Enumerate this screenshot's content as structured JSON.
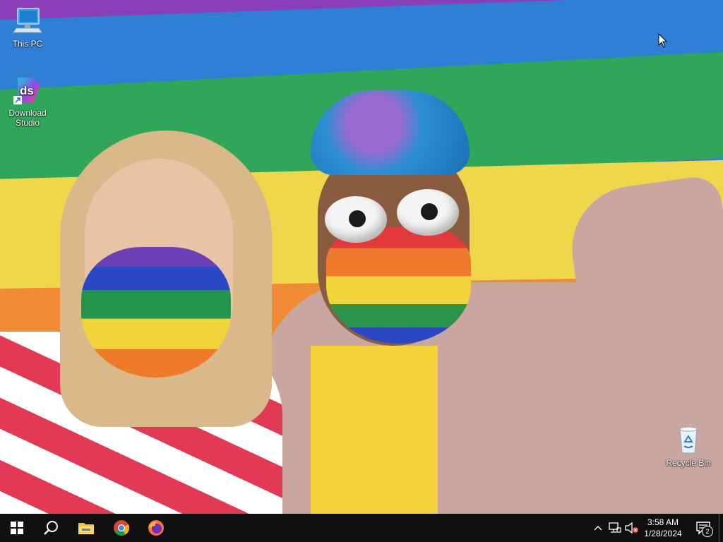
{
  "desktop": {
    "icons": [
      {
        "label": "This PC"
      },
      {
        "label": "Download\nStudio"
      },
      {
        "label": "Recycle Bin"
      }
    ]
  },
  "taskbar": {
    "pinned": [
      {
        "name": "start-icon"
      },
      {
        "name": "search-icon"
      },
      {
        "name": "file-explorer-icon"
      },
      {
        "name": "chrome-icon"
      },
      {
        "name": "firefox-icon"
      }
    ],
    "tray": {
      "time": "3:58 AM",
      "date": "1/28/2024",
      "notification_count": "2"
    }
  },
  "colors": {
    "taskbar_bg": "#101010",
    "start_blue": "#ffffff",
    "explorer_yellow": "#f3c53b"
  }
}
